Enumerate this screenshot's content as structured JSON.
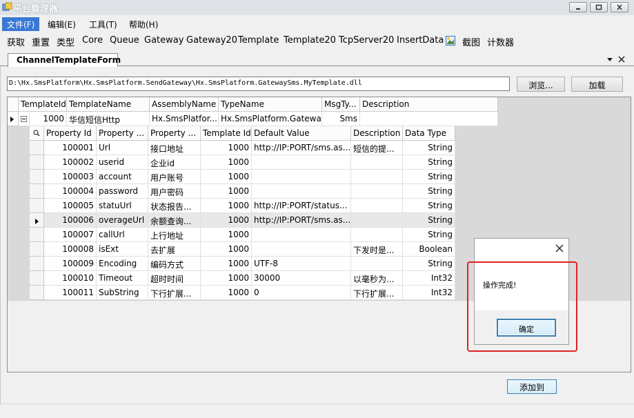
{
  "window": {
    "title": "平台管理器"
  },
  "menubar": {
    "items": [
      "文件(F)",
      "编辑(E)",
      "工具(T)",
      "帮助(H)"
    ]
  },
  "toolbar": {
    "items": [
      "获取",
      "重置",
      "类型",
      "Core",
      "Queue",
      "Gateway",
      "Gateway20",
      "Template",
      "Template20",
      "TcpServer20",
      "InsertData",
      "截图",
      "计数器"
    ]
  },
  "tab": {
    "label": "ChannelTemplateForm"
  },
  "path": {
    "value": "D:\\Hx.SmsPlatform\\Hx.SmsPlatform.SendGateway\\Hx.SmsPlatform.GatewaySms.MyTemplate.dll"
  },
  "buttons": {
    "browse": "浏览...",
    "load": "加载",
    "add_to": "添加到"
  },
  "master": {
    "columns": [
      "TemplateId",
      "TemplateName",
      "AssemblyName",
      "TypeName",
      "MsgTy...",
      "Description"
    ],
    "row": [
      "1000",
      "华信短信Http",
      "Hx.SmsPlatfor...",
      "Hx.SmsPlatform.Gatewa...",
      "Sms",
      ""
    ],
    "expand_symbol": "⊟"
  },
  "detail": {
    "columns": [
      "Property Id",
      "Property ...",
      "Property ...",
      "Template Id",
      "Default Value",
      "Description",
      "Data Type"
    ],
    "rows": [
      [
        "100001",
        "Url",
        "接口地址",
        "1000",
        "http://IP:PORT/sms.as...",
        "短信的提...",
        "String"
      ],
      [
        "100002",
        "userid",
        "企业id",
        "1000",
        "",
        "",
        "String"
      ],
      [
        "100003",
        "account",
        "用户账号",
        "1000",
        "",
        "",
        "String"
      ],
      [
        "100004",
        "password",
        "用户密码",
        "1000",
        "",
        "",
        "String"
      ],
      [
        "100005",
        "statuUrl",
        "状态报告...",
        "1000",
        "http://IP:PORT/status...",
        "",
        "String"
      ],
      [
        "100006",
        "overageUrl",
        "余额查询...",
        "1000",
        "http://IP:PORT/sms.as...",
        "",
        "String"
      ],
      [
        "100007",
        "callUrl",
        "上行地址",
        "1000",
        "",
        "",
        "String"
      ],
      [
        "100008",
        "isExt",
        "去扩展",
        "1000",
        "",
        "下发时是...",
        "Boolean"
      ],
      [
        "100009",
        "Encoding",
        "编码方式",
        "1000",
        "UTF-8",
        "",
        "String"
      ],
      [
        "100010",
        "Timeout",
        "超时时间",
        "1000",
        "30000",
        "以毫秒为...",
        "Int32"
      ],
      [
        "100011",
        "SubString",
        "下行扩展...",
        "1000",
        "0",
        "下行扩展...",
        "Int32"
      ]
    ],
    "current_row_index": 5
  },
  "dialog": {
    "message": "操作完成!",
    "ok_label": "确定"
  },
  "colors": {
    "menu_highlight": "#3a78d4",
    "annotation_red": "#e02020"
  }
}
